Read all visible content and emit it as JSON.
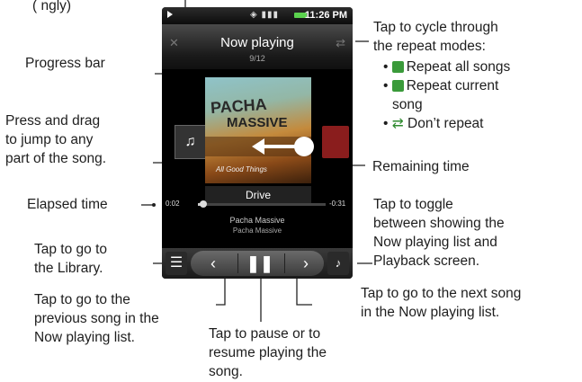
{
  "status_bar": {
    "time": "11:26 PM"
  },
  "title_bar": {
    "title": "Now playing",
    "track_count": "9/12"
  },
  "album_art": {
    "band": "PACHA",
    "band2": "MASSIVE",
    "subtitle": "All Good Things"
  },
  "song": {
    "title": "Drive",
    "artist": "Pacha Massive",
    "album": "Pacha Massive"
  },
  "playback": {
    "elapsed": "0:02",
    "remaining": "-0:31",
    "progress_fraction": 0.04
  },
  "annotations": {
    "repeat": [
      "Tap to cycle through",
      "the repeat modes:"
    ],
    "repeat_all": "Repeat all songs",
    "repeat_current": "Repeat current",
    "repeat_current2": "song",
    "dont_repeat": "Don’t repeat",
    "progress_bar": "Progress bar",
    "drag": [
      "Press and drag",
      "to jump to any",
      "part of the song."
    ],
    "remaining_time": "Remaining time",
    "elapsed_time": "Elapsed time",
    "toggle": [
      "Tap to toggle",
      "between showing the",
      "Now playing list and",
      "Playback screen."
    ],
    "library": [
      "Tap to go to",
      "the Library."
    ],
    "previous": [
      "Tap to go to the",
      "previous song in the",
      "Now playing list."
    ],
    "next": [
      "Tap to go to the next song",
      "in the Now playing list."
    ],
    "pause": [
      "Tap to pause or to",
      "resume playing the",
      "song."
    ],
    "top_partial": "(                                    ngly)"
  },
  "colors": {
    "repeat_all": "#3a9a3a",
    "repeat_current": "#3a9a3a",
    "dont_repeat": "#2f8a2f"
  }
}
